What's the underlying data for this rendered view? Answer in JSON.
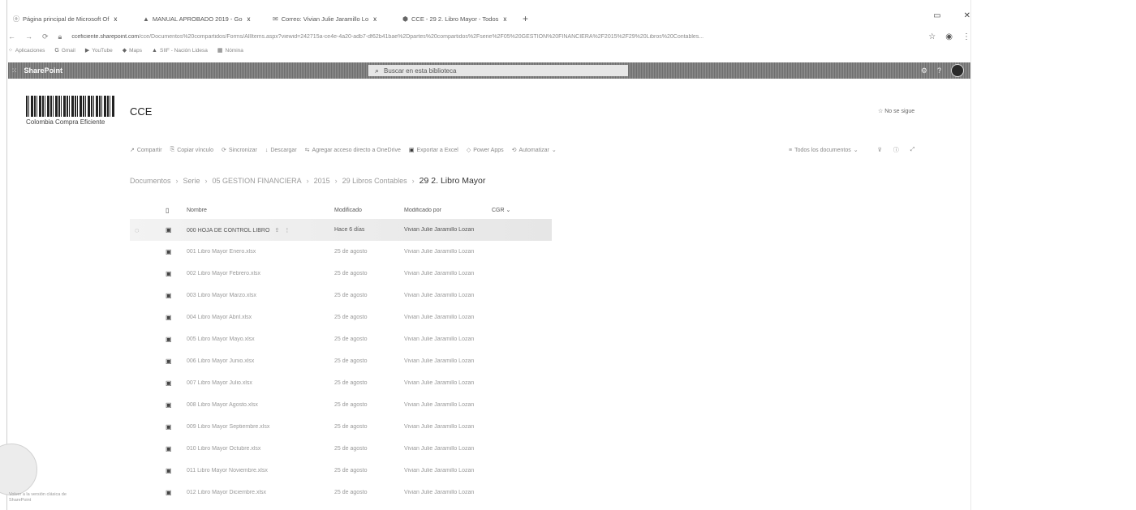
{
  "browser": {
    "tabs": [
      {
        "icon": "ⓞ",
        "label": "Página principal de Microsoft Of"
      },
      {
        "icon": "▲",
        "label": "MANUAL APROBADO 2019 - Go"
      },
      {
        "icon": "✉",
        "label": "Correo: Vivian Julie Jaramillo Lo"
      },
      {
        "icon": "⬢",
        "label": "CCE - 29 2. Libro Mayor - Todos"
      }
    ],
    "new_tab": "+",
    "url_host": "cceficiente.sharepoint.com",
    "url_path": "/cce/Documentos%20compartidos/Forms/AllItems.aspx?viewid=242715a-ce4e-4a20-adb7-df62b41bae%2Dpartes%20compartidos%2Fserie%2F05%20GESTION%20FINANCIERA%2F2015%2F29%20Libros%20Contables...",
    "bookmarks": [
      {
        "icon": "⁘",
        "label": "Aplicaciones"
      },
      {
        "icon": "G",
        "label": "Gmail"
      },
      {
        "icon": "▶",
        "label": "YouTube"
      },
      {
        "icon": "◆",
        "label": "Maps"
      },
      {
        "icon": "▲",
        "label": "SIIF - Nación Lidesa"
      },
      {
        "icon": "▦",
        "label": "Nómina"
      }
    ]
  },
  "suitebar": {
    "app_name": "SharePoint",
    "search_placeholder": "Buscar en esta biblioteca"
  },
  "site": {
    "logo_text": "Colombia Compra Eficiente",
    "title": "CCE",
    "follow_label": "No se sigue"
  },
  "commands": [
    {
      "icon": "↗",
      "label": "Compartir"
    },
    {
      "icon": "⎘",
      "label": "Copiar vínculo"
    },
    {
      "icon": "⟳",
      "label": "Sincronizar"
    },
    {
      "icon": "↓",
      "label": "Descargar"
    },
    {
      "icon": "⇆",
      "label": "Agregar acceso directo a OneDrive"
    },
    {
      "icon": "▣",
      "label": "Exportar a Excel"
    },
    {
      "icon": "◇",
      "label": "Power Apps"
    },
    {
      "icon": "⟲",
      "label": "Automatizar"
    }
  ],
  "view_selector": "Todos los documentos",
  "breadcrumb": {
    "items": [
      "Documentos",
      "Serie",
      "05 GESTION FINANCIERA",
      "2015",
      "29 Libros Contables"
    ],
    "current": "29 2. Libro Mayor"
  },
  "table": {
    "headers": {
      "name": "Nombre",
      "modified": "Modificado",
      "modified_by": "Modificado por",
      "cgr": "CGR"
    },
    "rows": [
      {
        "name": "000 HOJA DE CONTROL LIBRO",
        "modified": "Hace 6 días",
        "modified_by": "Vivian Julie Jaramillo Lozan"
      },
      {
        "name": "001 Libro Mayor Enero.xlsx",
        "modified": "25 de agosto",
        "modified_by": "Vivian Julie Jaramillo Lozan"
      },
      {
        "name": "002 Libro Mayor Febrero.xlsx",
        "modified": "25 de agosto",
        "modified_by": "Vivian Julie Jaramillo Lozan"
      },
      {
        "name": "003 Libro Mayor Marzo.xlsx",
        "modified": "25 de agosto",
        "modified_by": "Vivian Julie Jaramillo Lozan"
      },
      {
        "name": "004 Libro Mayor Abril.xlsx",
        "modified": "25 de agosto",
        "modified_by": "Vivian Julie Jaramillo Lozan"
      },
      {
        "name": "005 Libro Mayor Mayo.xlsx",
        "modified": "25 de agosto",
        "modified_by": "Vivian Julie Jaramillo Lozan"
      },
      {
        "name": "006 Libro Mayor Junio.xlsx",
        "modified": "25 de agosto",
        "modified_by": "Vivian Julie Jaramillo Lozan"
      },
      {
        "name": "007 Libro Mayor Julio.xlsx",
        "modified": "25 de agosto",
        "modified_by": "Vivian Julie Jaramillo Lozan"
      },
      {
        "name": "008 Libro Mayor Agosto.xlsx",
        "modified": "25 de agosto",
        "modified_by": "Vivian Julie Jaramillo Lozan"
      },
      {
        "name": "009 Libro Mayor Septiembre.xlsx",
        "modified": "25 de agosto",
        "modified_by": "Vivian Julie Jaramillo Lozan"
      },
      {
        "name": "010 Libro Mayor Octubre.xlsx",
        "modified": "25 de agosto",
        "modified_by": "Vivian Julie Jaramillo Lozan"
      },
      {
        "name": "011 Libro Mayor Noviembre.xlsx",
        "modified": "25 de agosto",
        "modified_by": "Vivian Julie Jaramillo Lozan"
      },
      {
        "name": "012 Libro Mayor Diciembre.xlsx",
        "modified": "25 de agosto",
        "modified_by": "Vivian Julie Jaramillo Lozan"
      }
    ]
  },
  "return_classic": "Volver a la versión clásica de SharePoint"
}
